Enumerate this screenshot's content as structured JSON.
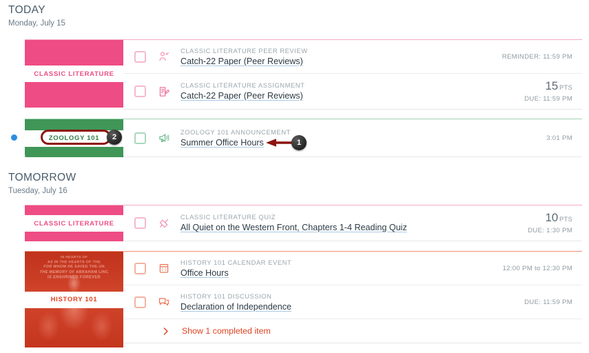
{
  "days": [
    {
      "title": "TODAY",
      "date": "Monday, July 15",
      "groups": [
        {
          "course_label": "CLASSIC LITERATURE",
          "accent": "#ee4c84",
          "card_style": "solid-pink",
          "unread": false,
          "items": [
            {
              "context": "CLASSIC LITERATURE PEER REVIEW",
              "title": "Catch-22 Paper (Peer Reviews)",
              "icon": "peer-review-icon",
              "meta": "REMINDER: 11:59 PM",
              "points": null,
              "points_label": null
            },
            {
              "context": "CLASSIC LITERATURE ASSIGNMENT",
              "title": "Catch-22 Paper (Peer Reviews)",
              "icon": "assignment-icon",
              "meta": "DUE: 11:59 PM",
              "points": "15",
              "points_label": "PTS"
            }
          ]
        },
        {
          "course_label": "ZOOLOGY 101",
          "accent": "#3f9657",
          "card_style": "leaf-photo",
          "unread": true,
          "items": [
            {
              "context": "ZOOLOGY 101 ANNOUNCEMENT",
              "title": "Summer Office Hours",
              "icon": "announcement-icon",
              "meta": "3:01 PM",
              "points": null,
              "points_label": null
            }
          ]
        }
      ]
    },
    {
      "title": "TOMORROW",
      "date": "Tuesday, July 16",
      "groups": [
        {
          "course_label": "CLASSIC LITERATURE",
          "accent": "#ee4c84",
          "card_style": "solid-pink",
          "unread": false,
          "items": [
            {
              "context": "CLASSIC LITERATURE QUIZ",
              "title": "All Quiet on the Western Front, Chapters 1-4 Reading Quiz",
              "icon": "quiz-icon",
              "meta": "DUE: 1:30 PM",
              "points": "10",
              "points_label": "PTS"
            }
          ]
        },
        {
          "course_label": "HISTORY 101",
          "accent": "#e0411f",
          "card_style": "lincoln-photo",
          "unread": false,
          "items": [
            {
              "context": "HISTORY 101 CALENDAR EVENT",
              "title": "Office Hours",
              "icon": "calendar-icon",
              "meta": "12:00 PM to 12:30 PM",
              "points": null,
              "points_label": null
            },
            {
              "context": "HISTORY 101 DISCUSSION",
              "title": "Declaration of Independence",
              "icon": "discussion-icon",
              "meta": "DUE: 11:59 PM",
              "points": null,
              "points_label": null
            }
          ],
          "completed_toggle": {
            "label": "Show 1 completed item",
            "icon": "chevron-right-icon"
          }
        }
      ]
    }
  ],
  "card_engraving": "IN HEARTS OF\nAS IN THE HEARTS OF THE\nFOR WHOM HE SAVED THE UN\nTHE MEMORY OF ABRAHAM LINC\nIS ENSHRINED FOREVER",
  "annotations": [
    {
      "number": "1",
      "kind": "arrow-callout",
      "target": "Summer Office Hours"
    },
    {
      "number": "2",
      "kind": "ring-callout",
      "target": "ZOOLOGY 101"
    }
  ],
  "colors": {
    "annotation_red": "#8d1410",
    "unread_blue": "#2b8ee0",
    "link_underline": "#a7c8e6",
    "classic_literature": "#ee4c84",
    "zoology": "#3f9657",
    "history": "#e0411f"
  }
}
